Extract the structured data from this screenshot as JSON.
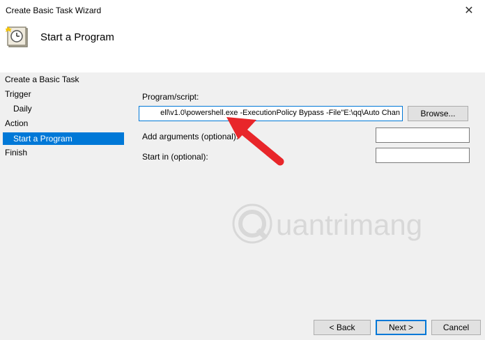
{
  "window": {
    "title": "Create Basic Task Wizard",
    "close_glyph": "✕"
  },
  "header": {
    "title": "Start a Program",
    "icon": "clock-task-icon"
  },
  "sidebar": {
    "items": [
      {
        "label": "Create a Basic Task"
      },
      {
        "label": "Trigger"
      },
      {
        "label": "Daily"
      },
      {
        "label": "Action"
      },
      {
        "label": "Start a Program"
      },
      {
        "label": "Finish"
      }
    ],
    "selected_color": "#0078d7"
  },
  "form": {
    "program_label": "Program/script:",
    "program_value": "ell\\v1.0\\powershell.exe -ExecutionPolicy Bypass -File\"E:\\qq\\Auto Chan",
    "browse_label": "Browse...",
    "arguments_label": "Add arguments (optional):",
    "arguments_value": "",
    "start_in_label": "Start in (optional):",
    "start_in_value": ""
  },
  "footer": {
    "back_label": "< Back",
    "next_label": "Next >",
    "cancel_label": "Cancel"
  },
  "overlay": {
    "watermark_text": "uantrimang",
    "arrow_color": "#e8262a"
  }
}
